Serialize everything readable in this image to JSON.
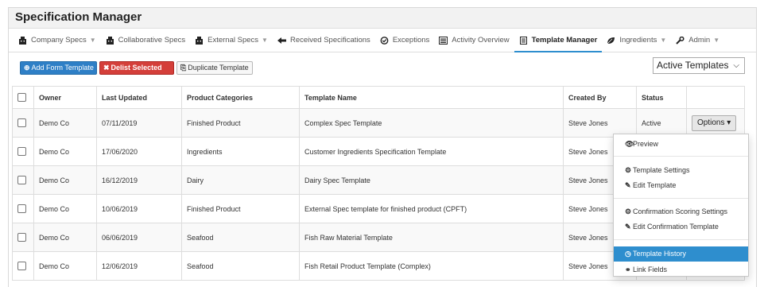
{
  "app": {
    "title": "Specification Manager"
  },
  "nav": {
    "items": [
      {
        "label": "Company Specs",
        "icon": "building-icon",
        "dropdown": true
      },
      {
        "label": "Collaborative Specs",
        "icon": "building-icon",
        "dropdown": false
      },
      {
        "label": "External Specs",
        "icon": "building-icon",
        "dropdown": true
      },
      {
        "label": "Received Specifications",
        "icon": "arrow-left-icon",
        "dropdown": false
      },
      {
        "label": "Exceptions",
        "icon": "check-circle-icon",
        "dropdown": false
      },
      {
        "label": "Activity Overview",
        "icon": "list-icon",
        "dropdown": false
      },
      {
        "label": "Template Manager",
        "icon": "document-icon",
        "dropdown": false,
        "active": true
      },
      {
        "label": "Ingredients",
        "icon": "leaf-icon",
        "dropdown": true
      },
      {
        "label": "Admin",
        "icon": "wrench-icon",
        "dropdown": true
      }
    ]
  },
  "toolbar": {
    "add_label": "Add Form Template",
    "delist_label": "Delist Selected",
    "duplicate_label": "Duplicate Template"
  },
  "filter": {
    "selected": "Active Templates"
  },
  "table": {
    "headers": [
      "Owner",
      "Last Updated",
      "Product Categories",
      "Template Name",
      "Created By",
      "Status"
    ],
    "rows": [
      {
        "owner": "Demo Co",
        "updated": "07/11/2019",
        "category": "Finished Product",
        "name": "Complex Spec Template",
        "created_by": "Steve Jones",
        "status": "Active"
      },
      {
        "owner": "Demo Co",
        "updated": "17/06/2020",
        "category": "Ingredients",
        "name": "Customer Ingredients Specification Template",
        "created_by": "Steve Jones",
        "status": ""
      },
      {
        "owner": "Demo Co",
        "updated": "16/12/2019",
        "category": "Dairy",
        "name": "Dairy Spec Template",
        "created_by": "Steve Jones",
        "status": ""
      },
      {
        "owner": "Demo Co",
        "updated": "10/06/2019",
        "category": "Finished Product",
        "name": "External Spec template for finished product (CPFT)",
        "created_by": "Steve Jones",
        "status": ""
      },
      {
        "owner": "Demo Co",
        "updated": "06/06/2019",
        "category": "Seafood",
        "name": "Fish Raw Material Template",
        "created_by": "Steve Jones",
        "status": ""
      },
      {
        "owner": "Demo Co",
        "updated": "12/06/2019",
        "category": "Seafood",
        "name": "Fish Retail Product Template (Complex)",
        "created_by": "Steve Jones",
        "status": ""
      }
    ],
    "options_label": "Options"
  },
  "options_menu": {
    "preview": "Preview",
    "template_settings": "Template Settings",
    "edit_template": "Edit Template",
    "confirmation_scoring": "Confirmation Scoring Settings",
    "edit_confirmation": "Edit Confirmation Template",
    "template_history": "Template History",
    "link_fields": "Link Fields"
  },
  "colors": {
    "accent": "#2e8ece",
    "primary_button": "#2e7fc6",
    "danger_button": "#d43f3a"
  }
}
